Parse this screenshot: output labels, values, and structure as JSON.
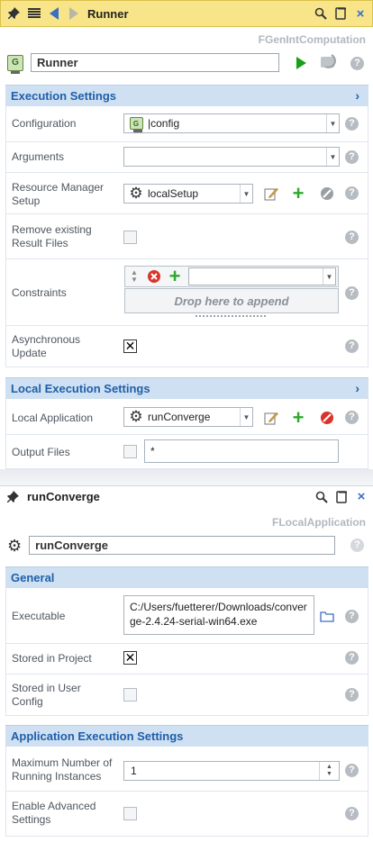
{
  "runner_panel": {
    "title": "Runner",
    "class_name": "FGenIntComputation",
    "name_value": "Runner",
    "execution_settings": {
      "header": "Execution Settings",
      "configuration_label": "Configuration",
      "configuration_value": "|config",
      "arguments_label": "Arguments",
      "arguments_value": "",
      "resource_manager_label": "Resource Manager Setup",
      "resource_manager_value": "localSetup",
      "remove_result_label": "Remove existing Result Files",
      "remove_result_checked": false,
      "constraints_label": "Constraints",
      "constraints_value": "",
      "drop_hint": "Drop here to append",
      "async_label": "Asynchronous Update",
      "async_checked": true
    },
    "local_execution_settings": {
      "header": "Local Execution Settings",
      "local_app_label": "Local Application",
      "local_app_value": "runConverge",
      "output_files_label": "Output Files",
      "output_files_checked": false,
      "output_files_value": "*"
    }
  },
  "app_panel": {
    "title": "runConverge",
    "class_name": "FLocalApplication",
    "name_value": "runConverge",
    "general": {
      "header": "General",
      "executable_label": "Executable",
      "executable_value": "C:/Users/fuetterer/Downloads/converge-2.4.24-serial-win64.exe",
      "stored_project_label": "Stored in Project",
      "stored_project_checked": true,
      "stored_user_label": "Stored in User Config",
      "stored_user_checked": false
    },
    "app_exec_settings": {
      "header": "Application Execution Settings",
      "max_instances_label": "Maximum Number of Running Instances",
      "max_instances_value": "1",
      "advanced_label": "Enable Advanced Settings",
      "advanced_checked": false
    }
  },
  "colors": {
    "title_bar": "#f8e58a",
    "section_header": "#cfe0f3",
    "section_text": "#1f5fa8",
    "run_green": "#19a019",
    "remove_red": "#d9342b"
  }
}
